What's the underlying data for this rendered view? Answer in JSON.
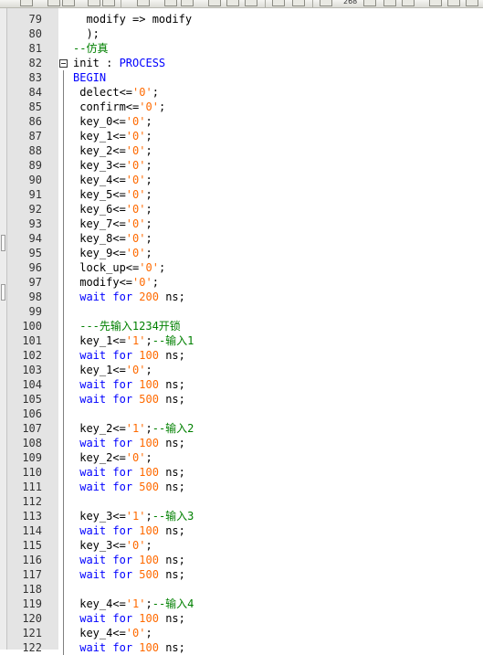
{
  "toolbar": {
    "zoom": "268"
  },
  "editor": {
    "lines": [
      {
        "n": "79",
        "fold": "none",
        "tokens": [
          {
            "t": "  modify => modify",
            "c": "op"
          }
        ]
      },
      {
        "n": "80",
        "fold": "none",
        "tokens": [
          {
            "t": "  );",
            "c": "op"
          }
        ]
      },
      {
        "n": "81",
        "fold": "none",
        "tokens": [
          {
            "t": "--仿真",
            "c": "cmt"
          }
        ]
      },
      {
        "n": "82",
        "fold": "open",
        "tokens": [
          {
            "t": "init : ",
            "c": "op"
          },
          {
            "t": "PROCESS",
            "c": "kw"
          }
        ]
      },
      {
        "n": "83",
        "fold": "line",
        "tokens": [
          {
            "t": "BEGIN",
            "c": "kw"
          }
        ]
      },
      {
        "n": "84",
        "fold": "line",
        "tokens": [
          {
            "t": " delect<=",
            "c": "op"
          },
          {
            "t": "'0'",
            "c": "num"
          },
          {
            "t": ";",
            "c": "op"
          }
        ]
      },
      {
        "n": "85",
        "fold": "line",
        "tokens": [
          {
            "t": " confirm<=",
            "c": "op"
          },
          {
            "t": "'0'",
            "c": "num"
          },
          {
            "t": ";",
            "c": "op"
          }
        ]
      },
      {
        "n": "86",
        "fold": "line",
        "tokens": [
          {
            "t": " key_0<=",
            "c": "op"
          },
          {
            "t": "'0'",
            "c": "num"
          },
          {
            "t": ";",
            "c": "op"
          }
        ]
      },
      {
        "n": "87",
        "fold": "line",
        "tokens": [
          {
            "t": " key_1<=",
            "c": "op"
          },
          {
            "t": "'0'",
            "c": "num"
          },
          {
            "t": ";",
            "c": "op"
          }
        ]
      },
      {
        "n": "88",
        "fold": "line",
        "tokens": [
          {
            "t": " key_2<=",
            "c": "op"
          },
          {
            "t": "'0'",
            "c": "num"
          },
          {
            "t": ";",
            "c": "op"
          }
        ]
      },
      {
        "n": "89",
        "fold": "line",
        "tokens": [
          {
            "t": " key_3<=",
            "c": "op"
          },
          {
            "t": "'0'",
            "c": "num"
          },
          {
            "t": ";",
            "c": "op"
          }
        ]
      },
      {
        "n": "90",
        "fold": "line",
        "tokens": [
          {
            "t": " key_4<=",
            "c": "op"
          },
          {
            "t": "'0'",
            "c": "num"
          },
          {
            "t": ";",
            "c": "op"
          }
        ]
      },
      {
        "n": "91",
        "fold": "line",
        "tokens": [
          {
            "t": " key_5<=",
            "c": "op"
          },
          {
            "t": "'0'",
            "c": "num"
          },
          {
            "t": ";",
            "c": "op"
          }
        ]
      },
      {
        "n": "92",
        "fold": "line",
        "tokens": [
          {
            "t": " key_6<=",
            "c": "op"
          },
          {
            "t": "'0'",
            "c": "num"
          },
          {
            "t": ";",
            "c": "op"
          }
        ]
      },
      {
        "n": "93",
        "fold": "line",
        "tokens": [
          {
            "t": " key_7<=",
            "c": "op"
          },
          {
            "t": "'0'",
            "c": "num"
          },
          {
            "t": ";",
            "c": "op"
          }
        ]
      },
      {
        "n": "94",
        "fold": "line",
        "tokens": [
          {
            "t": " key_8<=",
            "c": "op"
          },
          {
            "t": "'0'",
            "c": "num"
          },
          {
            "t": ";",
            "c": "op"
          }
        ]
      },
      {
        "n": "95",
        "fold": "line",
        "tokens": [
          {
            "t": " key_9<=",
            "c": "op"
          },
          {
            "t": "'0'",
            "c": "num"
          },
          {
            "t": ";",
            "c": "op"
          }
        ]
      },
      {
        "n": "96",
        "fold": "line",
        "tokens": [
          {
            "t": " lock_up<=",
            "c": "op"
          },
          {
            "t": "'0'",
            "c": "num"
          },
          {
            "t": ";",
            "c": "op"
          }
        ]
      },
      {
        "n": "97",
        "fold": "line",
        "tokens": [
          {
            "t": " modify<=",
            "c": "op"
          },
          {
            "t": "'0'",
            "c": "num"
          },
          {
            "t": ";",
            "c": "op"
          }
        ]
      },
      {
        "n": "98",
        "fold": "line",
        "tokens": [
          {
            "t": " ",
            "c": "op"
          },
          {
            "t": "wait",
            "c": "kw"
          },
          {
            "t": " ",
            "c": "op"
          },
          {
            "t": "for",
            "c": "kw"
          },
          {
            "t": " ",
            "c": "op"
          },
          {
            "t": "200",
            "c": "num"
          },
          {
            "t": " ns;",
            "c": "op"
          }
        ]
      },
      {
        "n": "99",
        "fold": "line",
        "tokens": []
      },
      {
        "n": "100",
        "fold": "line",
        "tokens": [
          {
            "t": " ---先输入1234开锁",
            "c": "cmt"
          }
        ]
      },
      {
        "n": "101",
        "fold": "line",
        "tokens": [
          {
            "t": " key_1<=",
            "c": "op"
          },
          {
            "t": "'1'",
            "c": "num"
          },
          {
            "t": ";",
            "c": "op"
          },
          {
            "t": "--输入1",
            "c": "cmt"
          }
        ]
      },
      {
        "n": "102",
        "fold": "line",
        "tokens": [
          {
            "t": " ",
            "c": "op"
          },
          {
            "t": "wait",
            "c": "kw"
          },
          {
            "t": " ",
            "c": "op"
          },
          {
            "t": "for",
            "c": "kw"
          },
          {
            "t": " ",
            "c": "op"
          },
          {
            "t": "100",
            "c": "num"
          },
          {
            "t": " ns;",
            "c": "op"
          }
        ]
      },
      {
        "n": "103",
        "fold": "line",
        "tokens": [
          {
            "t": " key_1<=",
            "c": "op"
          },
          {
            "t": "'0'",
            "c": "num"
          },
          {
            "t": ";",
            "c": "op"
          }
        ]
      },
      {
        "n": "104",
        "fold": "line",
        "tokens": [
          {
            "t": " ",
            "c": "op"
          },
          {
            "t": "wait",
            "c": "kw"
          },
          {
            "t": " ",
            "c": "op"
          },
          {
            "t": "for",
            "c": "kw"
          },
          {
            "t": " ",
            "c": "op"
          },
          {
            "t": "100",
            "c": "num"
          },
          {
            "t": " ns;",
            "c": "op"
          }
        ]
      },
      {
        "n": "105",
        "fold": "line",
        "tokens": [
          {
            "t": " ",
            "c": "op"
          },
          {
            "t": "wait",
            "c": "kw"
          },
          {
            "t": " ",
            "c": "op"
          },
          {
            "t": "for",
            "c": "kw"
          },
          {
            "t": " ",
            "c": "op"
          },
          {
            "t": "500",
            "c": "num"
          },
          {
            "t": " ns;",
            "c": "op"
          }
        ]
      },
      {
        "n": "106",
        "fold": "line",
        "tokens": []
      },
      {
        "n": "107",
        "fold": "line",
        "tokens": [
          {
            "t": " key_2<=",
            "c": "op"
          },
          {
            "t": "'1'",
            "c": "num"
          },
          {
            "t": ";",
            "c": "op"
          },
          {
            "t": "--输入2",
            "c": "cmt"
          }
        ]
      },
      {
        "n": "108",
        "fold": "line",
        "tokens": [
          {
            "t": " ",
            "c": "op"
          },
          {
            "t": "wait",
            "c": "kw"
          },
          {
            "t": " ",
            "c": "op"
          },
          {
            "t": "for",
            "c": "kw"
          },
          {
            "t": " ",
            "c": "op"
          },
          {
            "t": "100",
            "c": "num"
          },
          {
            "t": " ns;",
            "c": "op"
          }
        ]
      },
      {
        "n": "109",
        "fold": "line",
        "tokens": [
          {
            "t": " key_2<=",
            "c": "op"
          },
          {
            "t": "'0'",
            "c": "num"
          },
          {
            "t": ";",
            "c": "op"
          }
        ]
      },
      {
        "n": "110",
        "fold": "line",
        "tokens": [
          {
            "t": " ",
            "c": "op"
          },
          {
            "t": "wait",
            "c": "kw"
          },
          {
            "t": " ",
            "c": "op"
          },
          {
            "t": "for",
            "c": "kw"
          },
          {
            "t": " ",
            "c": "op"
          },
          {
            "t": "100",
            "c": "num"
          },
          {
            "t": " ns;",
            "c": "op"
          }
        ]
      },
      {
        "n": "111",
        "fold": "line",
        "tokens": [
          {
            "t": " ",
            "c": "op"
          },
          {
            "t": "wait",
            "c": "kw"
          },
          {
            "t": " ",
            "c": "op"
          },
          {
            "t": "for",
            "c": "kw"
          },
          {
            "t": " ",
            "c": "op"
          },
          {
            "t": "500",
            "c": "num"
          },
          {
            "t": " ns;",
            "c": "op"
          }
        ]
      },
      {
        "n": "112",
        "fold": "line",
        "tokens": []
      },
      {
        "n": "113",
        "fold": "line",
        "tokens": [
          {
            "t": " key_3<=",
            "c": "op"
          },
          {
            "t": "'1'",
            "c": "num"
          },
          {
            "t": ";",
            "c": "op"
          },
          {
            "t": "--输入3",
            "c": "cmt"
          }
        ]
      },
      {
        "n": "114",
        "fold": "line",
        "tokens": [
          {
            "t": " ",
            "c": "op"
          },
          {
            "t": "wait",
            "c": "kw"
          },
          {
            "t": " ",
            "c": "op"
          },
          {
            "t": "for",
            "c": "kw"
          },
          {
            "t": " ",
            "c": "op"
          },
          {
            "t": "100",
            "c": "num"
          },
          {
            "t": " ns;",
            "c": "op"
          }
        ]
      },
      {
        "n": "115",
        "fold": "line",
        "tokens": [
          {
            "t": " key_3<=",
            "c": "op"
          },
          {
            "t": "'0'",
            "c": "num"
          },
          {
            "t": ";",
            "c": "op"
          }
        ]
      },
      {
        "n": "116",
        "fold": "line",
        "tokens": [
          {
            "t": " ",
            "c": "op"
          },
          {
            "t": "wait",
            "c": "kw"
          },
          {
            "t": " ",
            "c": "op"
          },
          {
            "t": "for",
            "c": "kw"
          },
          {
            "t": " ",
            "c": "op"
          },
          {
            "t": "100",
            "c": "num"
          },
          {
            "t": " ns;",
            "c": "op"
          }
        ]
      },
      {
        "n": "117",
        "fold": "line",
        "tokens": [
          {
            "t": " ",
            "c": "op"
          },
          {
            "t": "wait",
            "c": "kw"
          },
          {
            "t": " ",
            "c": "op"
          },
          {
            "t": "for",
            "c": "kw"
          },
          {
            "t": " ",
            "c": "op"
          },
          {
            "t": "500",
            "c": "num"
          },
          {
            "t": " ns;",
            "c": "op"
          }
        ]
      },
      {
        "n": "118",
        "fold": "line",
        "tokens": []
      },
      {
        "n": "119",
        "fold": "line",
        "tokens": [
          {
            "t": " key_4<=",
            "c": "op"
          },
          {
            "t": "'1'",
            "c": "num"
          },
          {
            "t": ";",
            "c": "op"
          },
          {
            "t": "--输入4",
            "c": "cmt"
          }
        ]
      },
      {
        "n": "120",
        "fold": "line",
        "tokens": [
          {
            "t": " ",
            "c": "op"
          },
          {
            "t": "wait",
            "c": "kw"
          },
          {
            "t": " ",
            "c": "op"
          },
          {
            "t": "for",
            "c": "kw"
          },
          {
            "t": " ",
            "c": "op"
          },
          {
            "t": "100",
            "c": "num"
          },
          {
            "t": " ns;",
            "c": "op"
          }
        ]
      },
      {
        "n": "121",
        "fold": "line",
        "tokens": [
          {
            "t": " key_4<=",
            "c": "op"
          },
          {
            "t": "'0'",
            "c": "num"
          },
          {
            "t": ";",
            "c": "op"
          }
        ]
      },
      {
        "n": "122",
        "fold": "line",
        "tokens": [
          {
            "t": " ",
            "c": "op"
          },
          {
            "t": "wait",
            "c": "kw"
          },
          {
            "t": " ",
            "c": "op"
          },
          {
            "t": "for",
            "c": "kw"
          },
          {
            "t": " ",
            "c": "op"
          },
          {
            "t": "100",
            "c": "num"
          },
          {
            "t": " ns;",
            "c": "op"
          }
        ]
      }
    ]
  }
}
